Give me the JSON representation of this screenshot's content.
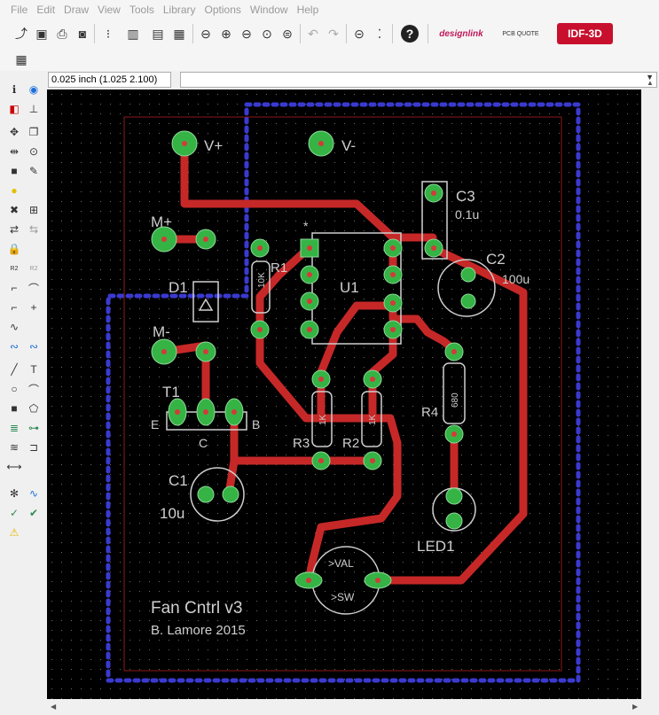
{
  "menu": [
    "File",
    "Edit",
    "Draw",
    "View",
    "Tools",
    "Library",
    "Options",
    "Window",
    "Help"
  ],
  "toolbar": {
    "designlink_label": "designlink",
    "pcbquote_label": "PCB QUOTE",
    "idf3d_label": "IDF-3D",
    "help_glyph": "?"
  },
  "coords": {
    "value": "0.025 inch (1.025 2.100)",
    "command": ""
  },
  "pcb": {
    "labels": {
      "vplus": "V+",
      "vminus": "V-",
      "mplus": "M+",
      "mminus": "M-",
      "d1": "D1",
      "t1": "T1",
      "t1_e": "E",
      "t1_c": "C",
      "t1_b": "B",
      "c1": "C1",
      "c1_val": "10u",
      "r1": "R1",
      "r1_val": "10K",
      "u1": "U1",
      "u1_star": "*",
      "c3": "C3",
      "c3_val": "0.1u",
      "c2": "C2",
      "c2_val": "100u",
      "r4": "R4",
      "r4_val": "680",
      "r3": "R3",
      "r3_val": "1K",
      "r2": "R2",
      "r2_val": "1K",
      "led1": "LED1",
      "pot_val": ">VAL",
      "pot_sw": ">SW",
      "title": "Fan Cntrl v3",
      "author": "B. Lamore 2015"
    },
    "colors": {
      "trace": "#c62828",
      "pad": "#35b344",
      "ground": "#3a3ad0",
      "outline": "#cfcfcf",
      "background": "#000000"
    }
  }
}
